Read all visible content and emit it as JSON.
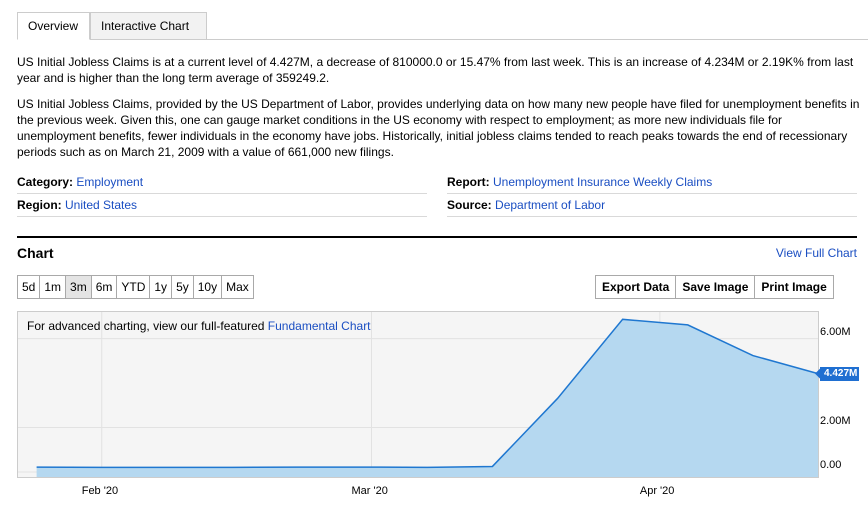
{
  "tabs": [
    {
      "label": "Overview",
      "active": true
    },
    {
      "label": "Interactive Chart",
      "active": false
    }
  ],
  "summary": "US Initial Jobless Claims is at a current level of 4.427M, a decrease of 810000.0 or 15.47% from last week. This is an increase of 4.234M or 2.19K% from last year and is higher than the long term average of 359249.2.",
  "description": "US Initial Jobless Claims, provided by the US Department of Labor, provides underlying data on how many new people have filed for unemployment benefits in the previous week. Given this, one can gauge market conditions in the US economy with respect to employment; as more new individuals file for unemployment benefits, fewer individuals in the economy have jobs. Historically, initial jobless claims tended to reach peaks towards the end of recessionary periods such as on March 21, 2009 with a value of 661,000 new filings.",
  "meta": {
    "category_label": "Category:",
    "category_value": "Employment",
    "region_label": "Region:",
    "region_value": "United States",
    "report_label": "Report:",
    "report_value": "Unemployment Insurance Weekly Claims",
    "source_label": "Source:",
    "source_value": "Department of Labor"
  },
  "chart_section": {
    "heading": "Chart",
    "view_full": "View Full Chart",
    "ranges": [
      "5d",
      "1m",
      "3m",
      "6m",
      "YTD",
      "1y",
      "5y",
      "10y",
      "Max"
    ],
    "active_range": "3m",
    "actions": [
      "Export Data",
      "Save Image",
      "Print Image"
    ],
    "note_prefix": "For advanced charting, view our full-featured ",
    "note_link": "Fundamental Chart",
    "current_value": "4.427M",
    "colors": {
      "line": "#1f77d0",
      "fill": "#b5d8f0",
      "tag": "#1f6fd1",
      "link": "#1a4ec2"
    }
  },
  "chart_data": {
    "type": "area",
    "x": [
      "2020-01-25",
      "2020-02-01",
      "2020-02-08",
      "2020-02-15",
      "2020-02-22",
      "2020-02-29",
      "2020-03-07",
      "2020-03-14",
      "2020-03-21",
      "2020-03-28",
      "2020-04-04",
      "2020-04-11",
      "2020-04-18"
    ],
    "values": [
      0.22,
      0.21,
      0.21,
      0.21,
      0.22,
      0.22,
      0.21,
      0.25,
      3.31,
      6.87,
      6.62,
      5.24,
      4.427
    ],
    "ylim": [
      0,
      7.2
    ],
    "y_ticks": [
      0,
      2,
      6
    ],
    "y_tick_labels": [
      "0.00",
      "2.00M",
      "6.00M"
    ],
    "x_tick_labels": [
      "Feb '20",
      "Mar '20",
      "Apr '20"
    ],
    "x_tick_dates": [
      "2020-02-01",
      "2020-03-01",
      "2020-04-01"
    ],
    "grid": true
  }
}
